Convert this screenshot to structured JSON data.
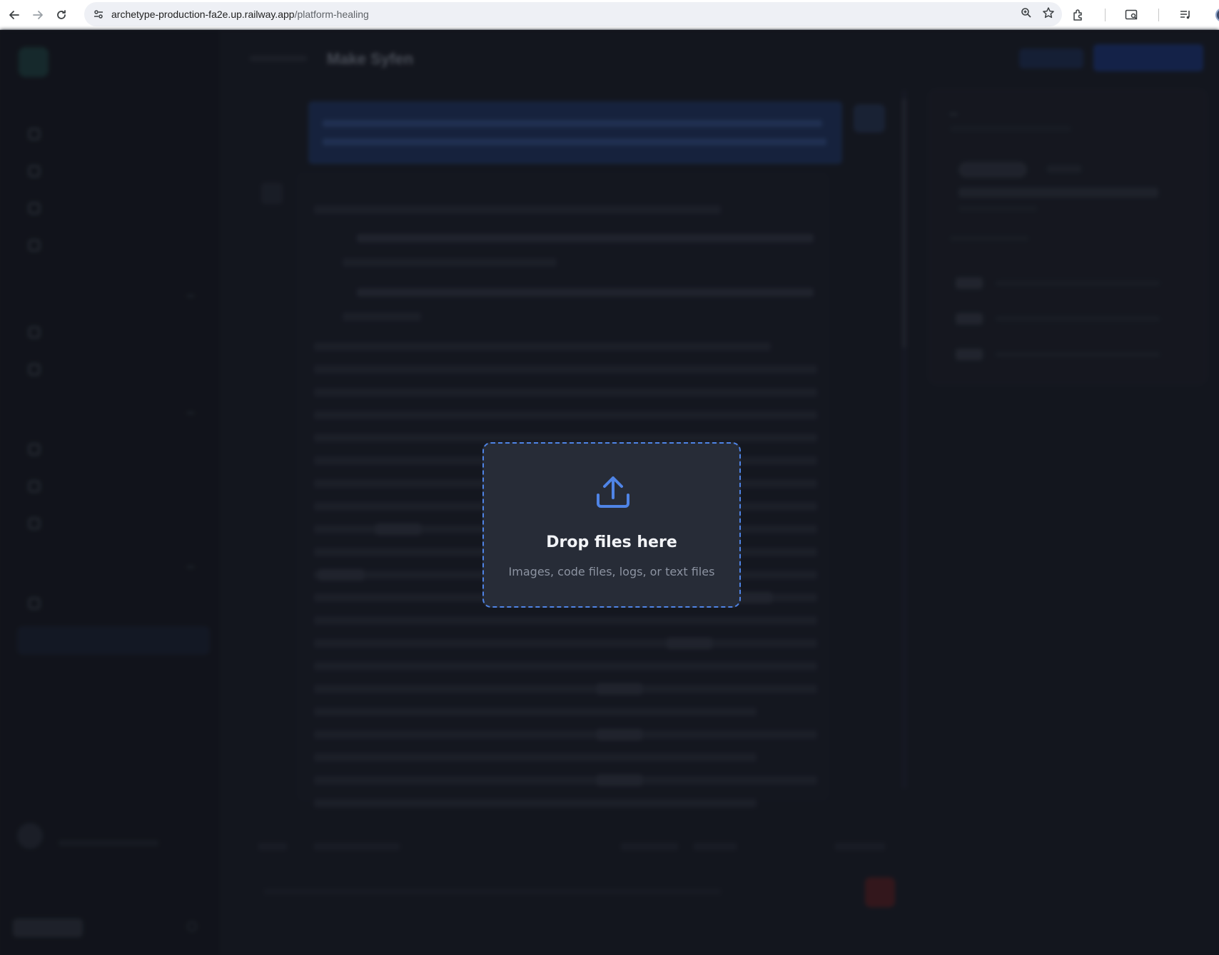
{
  "browser": {
    "url_host": "archetype-production-fa2e.up.railway.app",
    "url_path": "/platform-healing"
  },
  "page": {
    "title": "Make Syfen"
  },
  "drop_zone": {
    "icon": "upload-icon",
    "title": "Drop files here",
    "subtitle": "Images, code files, logs, or text files",
    "accent_color": "#4f84e6"
  }
}
